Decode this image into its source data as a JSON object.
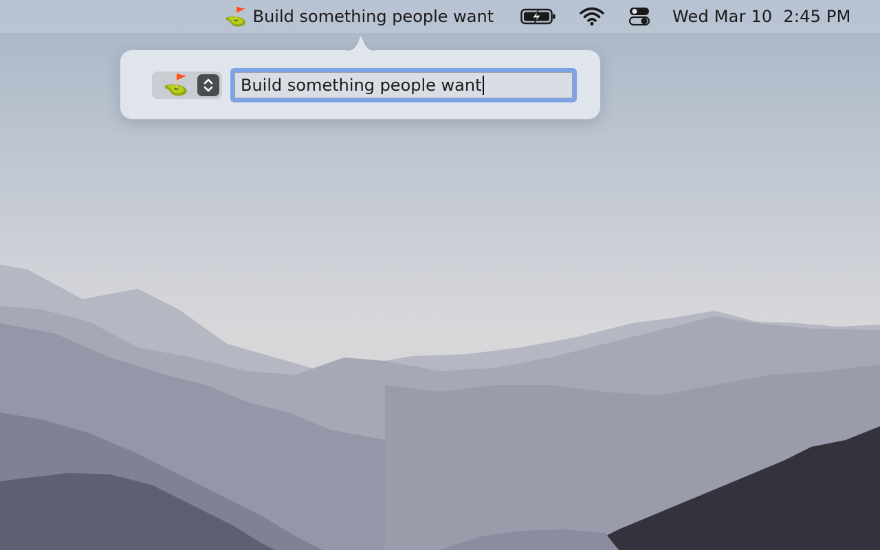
{
  "menubar": {
    "focus_item": {
      "emoji": "⛳️",
      "label": "Build something people want"
    },
    "battery_icon": "battery-charging-icon",
    "wifi_icon": "wifi-icon",
    "control_center_icon": "control-center-icon",
    "clock": {
      "date": "Wed Mar 10",
      "time": "2:45 PM"
    }
  },
  "popover": {
    "emoji_picker": {
      "selected_emoji": "⛳️",
      "stepper_icon": "chevron-up-down-icon"
    },
    "goal_field": {
      "value": "Build something people want"
    }
  },
  "colors": {
    "focus_ring": "#7ea2e6",
    "field_background": "#d9dde4",
    "popover_background": "#e2e6ed"
  }
}
